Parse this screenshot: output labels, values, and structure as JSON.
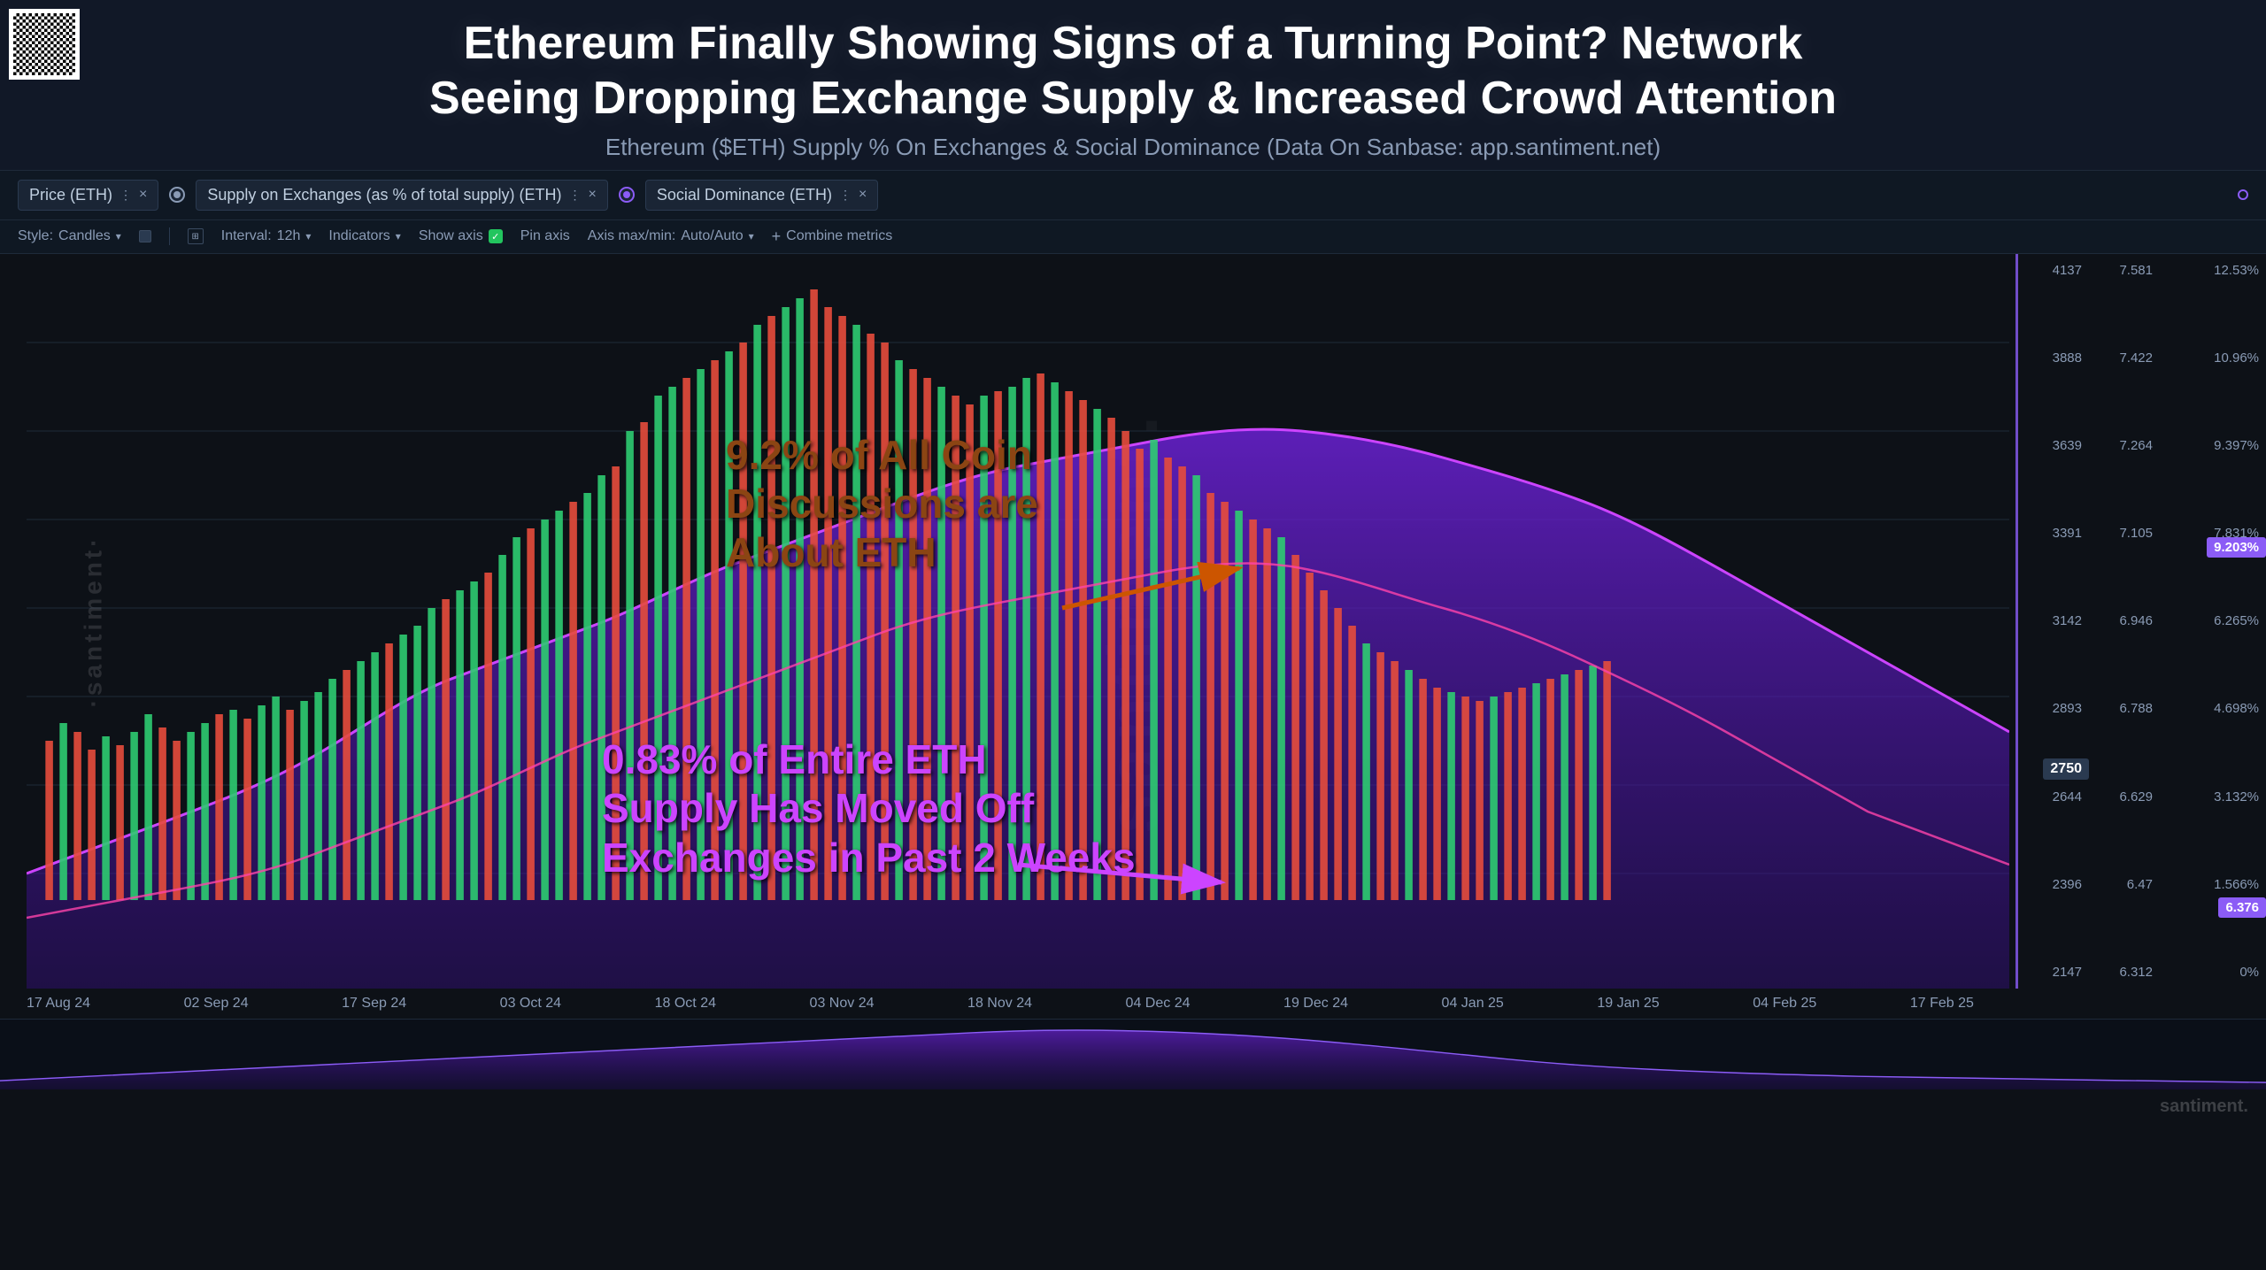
{
  "header": {
    "title": "Ethereum Finally Showing Signs of a Turning Point? Network",
    "title2": "Seeing Dropping Exchange Supply & Increased Crowd Attention",
    "subtitle": "Ethereum ($ETH) Supply % On Exchanges & Social Dominance (Data On Sanbase: app.santiment.net)"
  },
  "metrics": [
    {
      "label": "Price (ETH)",
      "color": "#ffffff",
      "has_close": true,
      "has_dot": false
    },
    {
      "label": "Supply on Exchanges (as % of total supply) (ETH)",
      "color": "#ff6b6b",
      "has_close": true,
      "has_dot": true
    },
    {
      "label": "Social Dominance (ETH)",
      "color": "#8b5cf6",
      "has_close": true,
      "has_dot": true
    }
  ],
  "controls": {
    "style_label": "Style:",
    "style_value": "Candles",
    "interval_label": "Interval:",
    "interval_value": "12h",
    "indicators_label": "Indicators",
    "show_axis_label": "Show axis",
    "pin_axis_label": "Pin axis",
    "axis_label": "Axis max/min:",
    "axis_value": "Auto/Auto",
    "combine_metrics_label": "Combine metrics"
  },
  "chart": {
    "annotation1_line1": "9.2% of All Coin",
    "annotation1_line2": "Discussions are",
    "annotation1_line3": "About ETH",
    "annotation2_line1": "0.83% of Entire ETH",
    "annotation2_line2": "Supply Has Moved Off",
    "annotation2_line3": "Exchanges in Past 2 Weeks",
    "price_badge": "2750",
    "social_badge": "6.376",
    "social_badge2": "9.203%",
    "y_axis_price": [
      "4137",
      "3888",
      "3639",
      "3391",
      "3142",
      "2893",
      "2644",
      "2396",
      "2147"
    ],
    "y_axis_supply": [
      "7.581",
      "7.422",
      "7.264",
      "7.105",
      "6.946",
      "6.788",
      "6.629",
      "6.47",
      "6.312"
    ],
    "y_axis_social": [
      "12.53%",
      "10.96%",
      "9.397%",
      "7.831%",
      "6.265%",
      "4.698%",
      "3.132%",
      "1.566%",
      "0%"
    ],
    "x_axis": [
      "17 Aug 24",
      "02 Sep 24",
      "17 Sep 24",
      "03 Oct 24",
      "18 Oct 24",
      "03 Nov 24",
      "18 Nov 24",
      "04 Dec 24",
      "19 Dec 24",
      "04 Jan 25",
      "19 Jan 25",
      "04 Feb 25",
      "17 Feb 25"
    ]
  },
  "watermark": "santiment.",
  "footer_watermark": "santiment."
}
